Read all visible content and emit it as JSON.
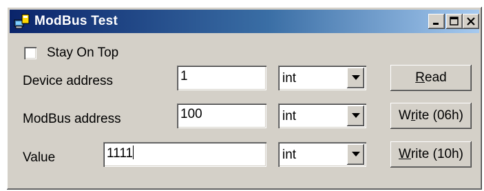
{
  "window": {
    "title": "ModBus Test",
    "icon": "computer-network-icon",
    "controls": [
      "minimize-icon",
      "maximize-icon",
      "close-icon"
    ]
  },
  "stay_on_top": {
    "label": "Stay On Top",
    "checked": false
  },
  "device_address": {
    "label": "Device address",
    "value": "1",
    "type": "int"
  },
  "modbus_address": {
    "label": "ModBus address",
    "value": "100",
    "type": "int"
  },
  "value_row": {
    "label": "Value",
    "value": "1111",
    "type": "int"
  },
  "buttons": {
    "read": {
      "accel": "R",
      "rest": "ead"
    },
    "write06": {
      "pre": "W",
      "accel": "r",
      "rest": "ite (06h)"
    },
    "write10": {
      "accel": "W",
      "rest": "rite (10h)"
    }
  }
}
